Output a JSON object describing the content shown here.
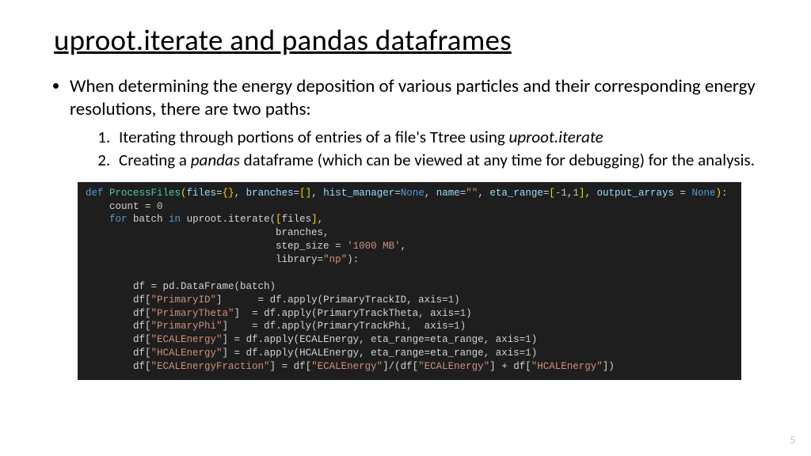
{
  "title": "uproot.iterate and pandas dataframes",
  "bullet_pre": "When determining the energy deposition of various particles and their corresponding energy resolutions, there are two paths:",
  "item1_pre": "Iterating through portions of entries of a file's Ttree using ",
  "item1_ital": "uproot.iterate",
  "item2_pre": "Creating a ",
  "item2_ital": "pandas",
  "item2_post": " dataframe (which can be viewed at any time for debugging) for the analysis.",
  "slide_number": "5",
  "code": {
    "def": "def ",
    "fname": "ProcessFiles",
    "lp": "(",
    "p_files": "files",
    "eq": "=",
    "br_open": "{",
    "br_close": "}",
    "c": ", ",
    "p_branches": "branches",
    "sq_open": "[",
    "sq_close": "]",
    "p_hm": "hist_manager",
    "none": "None",
    "p_name": "name",
    "s_empty": "\"\"",
    "p_eta": "eta_range",
    "n_neg1": "-1",
    "n_1": "1",
    "p_out": "output_arrays ",
    "eq2": "= ",
    "rp": "):",
    "l2_a": "    count ",
    "l2_b": "= ",
    "n_0": "0",
    "l3_a": "    ",
    "for": "for",
    "l3_b": " batch ",
    "in": "in",
    "l3_c": " uproot.iterate(",
    "l3_d": "files",
    "l3_e": ",",
    "l4": "                                branches,",
    "l5a": "                                step_size ",
    "l5b": "= ",
    "s_1000": "'1000 MB'",
    "l5c": ",",
    "l6a": "                                library",
    "l6b": "=",
    "s_np": "\"np\"",
    "l6c": "):",
    "blank": "",
    "l8a": "        df ",
    "l8b": "= ",
    "l8c": "pd.DataFrame(batch)",
    "l9a": "        df[",
    "s_pid": "\"PrimaryID\"",
    "l9b": "]      ",
    "l9c": "= ",
    "l9d": "df.apply(PrimaryTrackID, axis",
    "l9e": "=",
    "l9f": ")",
    "s_ptheta": "\"PrimaryTheta\"",
    "l10b": "]  ",
    "l10d": "df.apply(PrimaryTrackTheta, axis",
    "s_pphi": "\"PrimaryPhi\"",
    "l11b": "]    ",
    "l11d": "df.apply(PrimaryTrackPhi,  axis",
    "s_ecal": "\"ECALEnergy\"",
    "l12b": "] ",
    "l12d": "df.apply(ECALEnergy, eta_range",
    "l12e": "=",
    "l12f": "eta_range, axis",
    "s_hcal": "\"HCALEnergy\"",
    "l13d": "df.apply(HCALEnergy, eta_range",
    "s_efrac": "\"ECALEnergyFraction\"",
    "l14b": "] ",
    "l14c": "= ",
    "l14d": "df[",
    "l14e": "]",
    "l14f": "/(",
    "l14g": "df[",
    "l14h": "] ",
    "plus": "+ ",
    "l14i": "df[",
    "l14j": "])"
  }
}
